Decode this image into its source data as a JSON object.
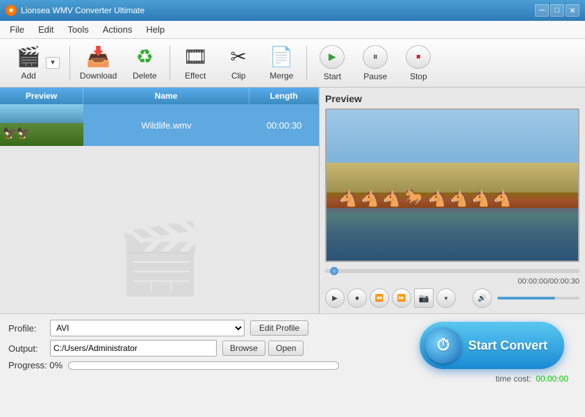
{
  "titleBar": {
    "icon": "★",
    "title": "Lionsea WMV Converter Ultimate",
    "minimizeLabel": "─",
    "maximizeLabel": "□",
    "closeLabel": "✕"
  },
  "menuBar": {
    "items": [
      "File",
      "Edit",
      "Tools",
      "Actions",
      "Help"
    ]
  },
  "toolbar": {
    "addLabel": "Add",
    "downloadLabel": "Download",
    "deleteLabel": "Delete",
    "effectLabel": "Effect",
    "clipLabel": "Clip",
    "mergeLabel": "Merge",
    "startLabel": "Start",
    "pauseLabel": "Pause",
    "stopLabel": "Stop"
  },
  "fileList": {
    "headers": [
      "Preview",
      "Name",
      "Length"
    ],
    "rows": [
      {
        "name": "Wildlife.wmv",
        "length": "00:00:30"
      }
    ]
  },
  "preview": {
    "label": "Preview",
    "timeDisplay": "00:00:00/00:00:30"
  },
  "bottom": {
    "profileLabel": "Profile:",
    "profileValue": "AVI",
    "editProfileLabel": "Edit Profile",
    "outputLabel": "Output:",
    "outputValue": "C:/Users/Administrator",
    "browseLabel": "Browse",
    "openLabel": "Open",
    "progressLabel": "Progress: 0%",
    "timeCostLabel": "time cost:",
    "timeCostValue": "00:00:00",
    "startConvertLabel": "Start Convert"
  }
}
